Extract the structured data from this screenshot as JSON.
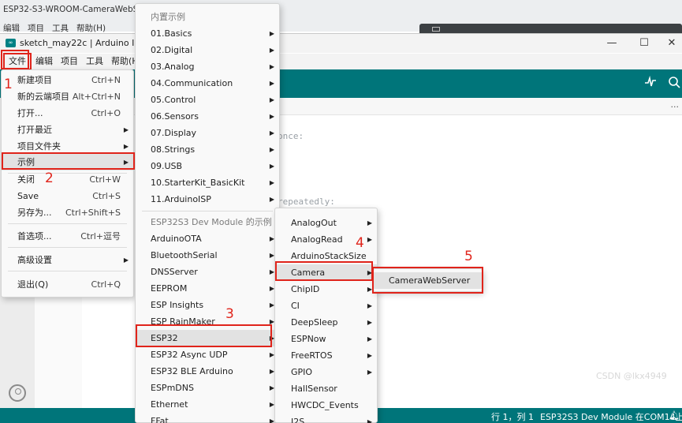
{
  "background_window": {
    "title": "ESP32-S3-WROOM-CameraWebServe",
    "menu": [
      "编辑",
      "项目",
      "工具",
      "帮助(H)"
    ]
  },
  "window": {
    "title": "sketch_may22c | Arduino IDE 2.",
    "minimize_icon": "minimize-icon",
    "maximize_icon": "maximize-icon",
    "close_icon": "close-icon"
  },
  "menubar": [
    "文件",
    "编辑",
    "项目",
    "工具",
    "帮助(H)"
  ],
  "toolbar_icons": [
    "serial-plotter-icon",
    "serial-monitor-icon"
  ],
  "tab_more": "...",
  "code_lines": [
    "once:",
    "repeatedly:"
  ],
  "file_menu": [
    {
      "label": "新建项目",
      "shortcut": "Ctrl+N"
    },
    {
      "label": "新的云端项目",
      "shortcut": "Alt+Ctrl+N"
    },
    {
      "label": "打开...",
      "shortcut": "Ctrl+O"
    },
    {
      "label": "打开最近",
      "shortcut": ""
    },
    {
      "label": "项目文件夹",
      "shortcut": ""
    },
    {
      "label": "示例",
      "shortcut": ""
    },
    {
      "label": "关闭",
      "shortcut": "Ctrl+W"
    },
    {
      "label": "Save",
      "shortcut": "Ctrl+S"
    },
    {
      "label": "另存为...",
      "shortcut": "Ctrl+Shift+S"
    },
    {
      "label": "首选项...",
      "shortcut": "Ctrl+逗号"
    },
    {
      "label": "高级设置",
      "shortcut": ""
    },
    {
      "label": "退出(Q)",
      "shortcut": "Ctrl+Q"
    }
  ],
  "examples_menu": {
    "builtin_header": "内置示例",
    "builtin": [
      "01.Basics",
      "02.Digital",
      "03.Analog",
      "04.Communication",
      "05.Control",
      "06.Sensors",
      "07.Display",
      "08.Strings",
      "09.USB",
      "10.StarterKit_BasicKit",
      "11.ArduinoISP"
    ],
    "board_header": "ESP32S3 Dev Module 的示例",
    "board": [
      "ArduinoOTA",
      "BluetoothSerial",
      "DNSServer",
      "EEPROM",
      "ESP Insights",
      "ESP RainMaker",
      "ESP32",
      "ESP32 Async UDP",
      "ESP32 BLE Arduino",
      "ESPmDNS",
      "Ethernet",
      "FFat"
    ]
  },
  "esp32_menu": [
    "AnalogOut",
    "AnalogRead",
    "ArduinoStackSize",
    "Camera",
    "ChipID",
    "CI",
    "DeepSleep",
    "ESPNow",
    "FreeRTOS",
    "GPIO",
    "HallSensor",
    "HWCDC_Events",
    "I2S"
  ],
  "camera_menu": [
    "CameraWebServer"
  ],
  "status": {
    "position": "行 1，列 1",
    "board": "ESP32S3 Dev Module 在COM14上",
    "notification_icon": "bell-icon"
  },
  "watermark": "CSDN @lkx4949",
  "step_numbers": [
    "1",
    "2",
    "3",
    "4",
    "5"
  ],
  "colors": {
    "teal": "#00757a",
    "annotation_red": "#e0241b",
    "highlight": "#e2e2e2"
  }
}
